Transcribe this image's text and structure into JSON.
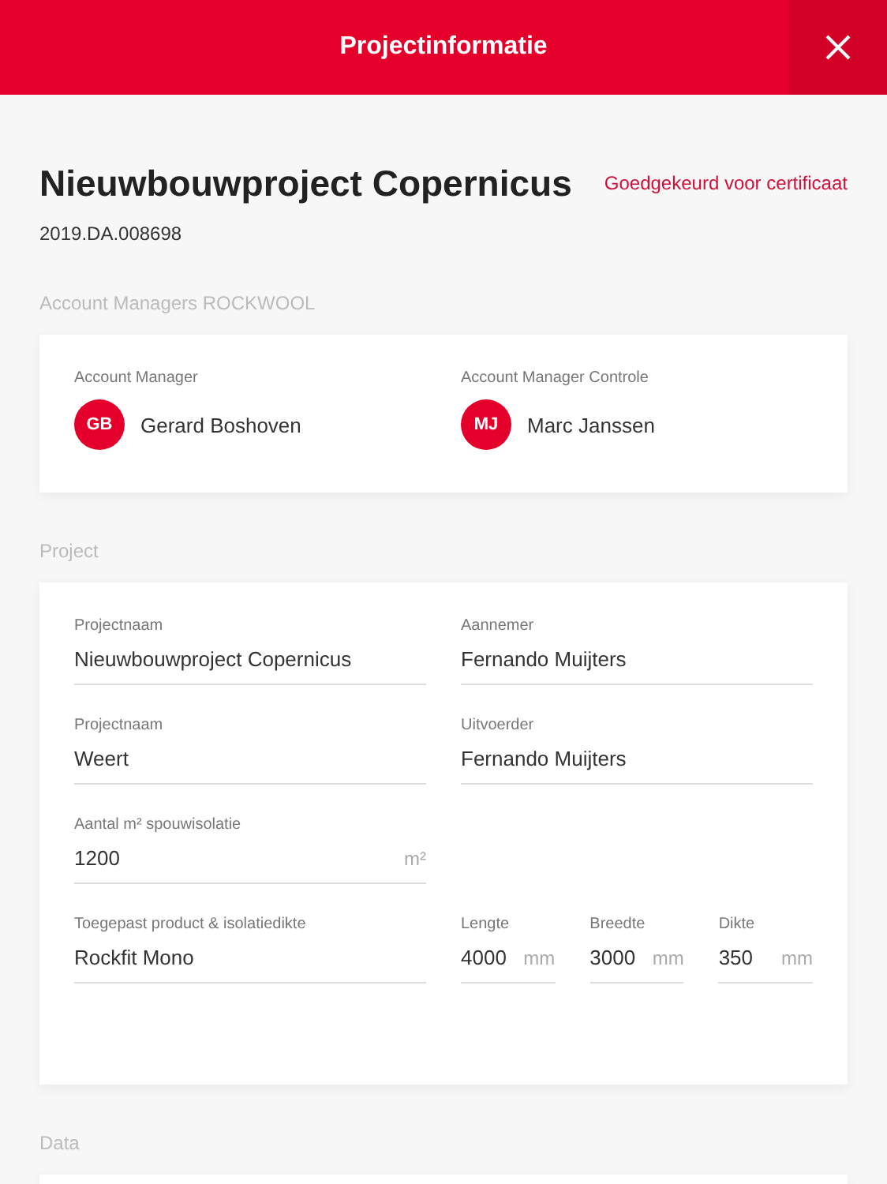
{
  "header": {
    "title": "Projectinformatie"
  },
  "project": {
    "name": "Nieuwbouwproject Copernicus",
    "status": "Goedgekeurd voor certificaat",
    "number": "2019.DA.008698"
  },
  "managers_section": {
    "label": "Account Managers ROCKWOOL",
    "managers": [
      {
        "role": "Account Manager",
        "initials": "GB",
        "name": "Gerard Boshoven"
      },
      {
        "role": "Account Manager Controle",
        "initials": "MJ",
        "name": "Marc Janssen"
      }
    ]
  },
  "project_section": {
    "label": "Project",
    "rows": [
      [
        {
          "kind": "field",
          "label": "Projectnaam",
          "value": "Nieuwbouwproject Copernicus"
        },
        {
          "kind": "field",
          "label": "Aannemer",
          "value": "Fernando Muijters"
        }
      ],
      [
        {
          "kind": "field",
          "label": "Projectnaam",
          "value": "Weert"
        },
        {
          "kind": "field",
          "label": "Uitvoerder",
          "value": "Fernando Muijters"
        }
      ],
      [
        {
          "kind": "field",
          "label": "Aantal m² spouwisolatie",
          "value": "1200",
          "unit": "m²"
        }
      ],
      [
        {
          "kind": "field",
          "label": "Toegepast product & isolatiedikte",
          "value": "Rockfit Mono"
        },
        {
          "kind": "group",
          "fields": [
            {
              "label": "Lengte",
              "value": "4000",
              "unit": "mm"
            },
            {
              "label": "Breedte",
              "value": "3000",
              "unit": "mm"
            },
            {
              "label": "Dikte",
              "value": "350",
              "unit": "mm"
            }
          ]
        }
      ]
    ]
  },
  "data_section": {
    "label": "Data"
  }
}
